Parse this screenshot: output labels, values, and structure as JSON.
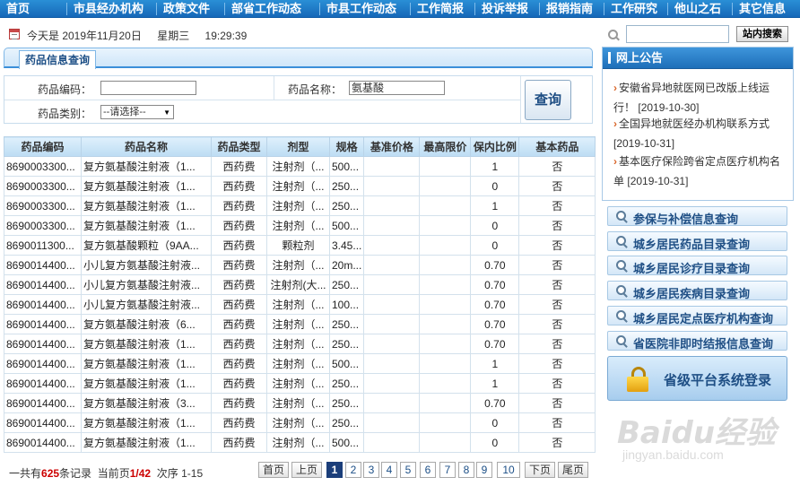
{
  "nav": [
    "首页",
    "市县经办机构",
    "政策文件",
    "部省工作动态",
    "市县工作动态",
    "工作简报",
    "投诉举报",
    "报销指南",
    "工作研究",
    "他山之石",
    "其它信息"
  ],
  "info": {
    "date_text": "今天是 2019年11月20日",
    "weekday": "星期三",
    "time": "19:29:39"
  },
  "search": {
    "value": "",
    "button": "站内搜索"
  },
  "tab": {
    "title": "药品信息查询"
  },
  "form": {
    "code_label": "药品编码：",
    "code_value": "",
    "name_label": "药品名称：",
    "name_value": "氨基酸",
    "type_label": "药品类别：",
    "type_value": "--请选择--",
    "query_button": "查询"
  },
  "table": {
    "columns": [
      "药品编码",
      "药品名称",
      "药品类型",
      "剂型",
      "规格",
      "基准价格",
      "最高限价",
      "保内比例",
      "基本药品"
    ],
    "rows": [
      [
        "8690003300...",
        "复方氨基酸注射液（1...",
        "西药费",
        "注射剂（...",
        "500...",
        "",
        "",
        "1",
        "否"
      ],
      [
        "8690003300...",
        "复方氨基酸注射液（1...",
        "西药费",
        "注射剂（...",
        "250...",
        "",
        "",
        "0",
        "否"
      ],
      [
        "8690003300...",
        "复方氨基酸注射液（1...",
        "西药费",
        "注射剂（...",
        "250...",
        "",
        "",
        "1",
        "否"
      ],
      [
        "8690003300...",
        "复方氨基酸注射液（1...",
        "西药费",
        "注射剂（...",
        "500...",
        "",
        "",
        "0",
        "否"
      ],
      [
        "8690011300...",
        "复方氨基酸颗粒（9AA...",
        "西药费",
        "颗粒剂",
        "3.45...",
        "",
        "",
        "0",
        "否"
      ],
      [
        "8690014400...",
        "小儿复方氨基酸注射液...",
        "西药费",
        "注射剂（...",
        "20m...",
        "",
        "",
        "0.70",
        "否"
      ],
      [
        "8690014400...",
        "小儿复方氨基酸注射液...",
        "西药费",
        "注射剂(大...",
        "250...",
        "",
        "",
        "0.70",
        "否"
      ],
      [
        "8690014400...",
        "小儿复方氨基酸注射液...",
        "西药费",
        "注射剂（...",
        "100...",
        "",
        "",
        "0.70",
        "否"
      ],
      [
        "8690014400...",
        "复方氨基酸注射液（6...",
        "西药费",
        "注射剂（...",
        "250...",
        "",
        "",
        "0.70",
        "否"
      ],
      [
        "8690014400...",
        "复方氨基酸注射液（1...",
        "西药费",
        "注射剂（...",
        "250...",
        "",
        "",
        "0.70",
        "否"
      ],
      [
        "8690014400...",
        "复方氨基酸注射液（1...",
        "西药费",
        "注射剂（...",
        "500...",
        "",
        "",
        "1",
        "否"
      ],
      [
        "8690014400...",
        "复方氨基酸注射液（1...",
        "西药费",
        "注射剂（...",
        "250...",
        "",
        "",
        "1",
        "否"
      ],
      [
        "8690014400...",
        "复方氨基酸注射液（3...",
        "西药费",
        "注射剂（...",
        "250...",
        "",
        "",
        "0.70",
        "否"
      ],
      [
        "8690014400...",
        "复方氨基酸注射液（1...",
        "西药费",
        "注射剂（...",
        "250...",
        "",
        "",
        "0",
        "否"
      ],
      [
        "8690014400...",
        "复方氨基酸注射液（1...",
        "西药费",
        "注射剂（...",
        "500...",
        "",
        "",
        "0",
        "否"
      ]
    ]
  },
  "pager": {
    "prefix": "一共有",
    "total": "625",
    "total_suffix": "条记录",
    "current_prefix": "当前页",
    "current": "1/42",
    "range": "次序 1-15",
    "first": "首页",
    "prev": "上页",
    "pages": [
      "1",
      "2",
      "3",
      "4",
      "5",
      "6",
      "7",
      "8",
      "9",
      "10"
    ],
    "next": "下页",
    "last": "尾页"
  },
  "notice": {
    "title": "网上公告",
    "items": [
      {
        "text": "安徽省异地就医网已改版上线运行！",
        "date": "[2019-10-30]"
      },
      {
        "text": "全国异地就医经办机构联系方式",
        "date": "[2019-10-31]"
      },
      {
        "text": "基本医疗保险跨省定点医疗机构名单",
        "date": "[2019-10-31]"
      }
    ]
  },
  "links": [
    "参保与补偿信息查询",
    "城乡居民药品目录查询",
    "城乡居民诊疗目录查询",
    "城乡居民疾病目录查询",
    "城乡居民定点医疗机构查询",
    "省医院非即时结报信息查询"
  ],
  "login": {
    "label": "省级平台系统登录"
  },
  "watermark": {
    "logo": "Baidu经验",
    "url": "jingyan.baidu.com"
  },
  "colors": {
    "nav": "#1668b8",
    "accent": "#3b8fd9",
    "highlight": "#cc0000"
  }
}
